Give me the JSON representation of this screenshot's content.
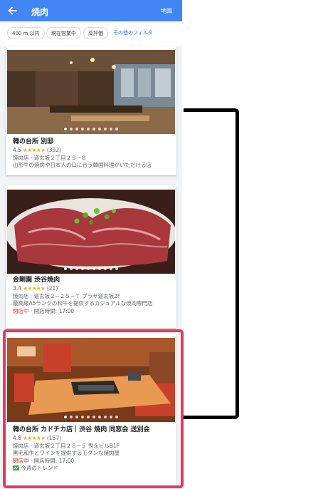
{
  "appbar": {
    "title": "焼肉",
    "map_label": "地図",
    "back_icon": "arrow-back-icon"
  },
  "filters": [
    "400 m 以内",
    "現在営業中",
    "高評価",
    "その他のフィルタ"
  ],
  "colors": {
    "appbar": "#4285f4",
    "highlight": "#e8385c",
    "stars": "#f4b400",
    "closed": "#d93025",
    "link": "#1a73e8"
  },
  "results": [
    {
      "name": "韓の台所 別邸",
      "rating": "4.5",
      "stars": "★★★★★",
      "reviews": "(392)",
      "address": "焼肉店 · 道玄坂２丁目２９−８",
      "description": "山形牛の焼肉や日本人の口に合う韓国料理がいただける店"
    },
    {
      "name": "金剛園 渋谷焼肉",
      "rating": "3.4",
      "stars": "★★★★★",
      "reviews": "(21)",
      "address": "焼肉店 · 道玄坂２−２５−７ プラザ道玄坂2F",
      "description": "最高級A5ランクの和牛を提供するカジュアルな焼肉専門店",
      "status": "閉店中",
      "hours": " · 開店時間: 17:00"
    },
    {
      "name": "韓の台所 カドチカ店｜渋谷 焼肉 同窓会 送別会",
      "rating": "4.8",
      "stars": "★★★★★",
      "reviews": "(157)",
      "address": "焼肉店 · 道玄坂２丁目２８−５ 秀永ビルB1F",
      "description": "黒毛和牛とワインを提供するモダンな焼肉屋",
      "status": "閉店中",
      "hours": " · 開店時間: 17:00",
      "trend": "今週のトレンド"
    }
  ]
}
